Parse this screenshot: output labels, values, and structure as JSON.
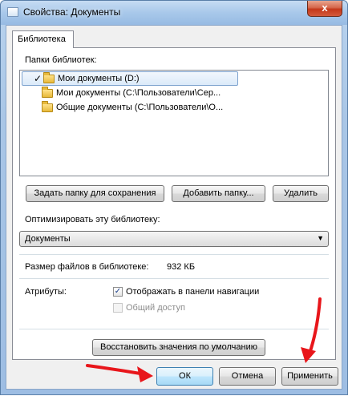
{
  "window": {
    "title": "Свойства: Документы",
    "close_glyph": "x"
  },
  "tabs": [
    {
      "label": "Библиотека"
    }
  ],
  "library": {
    "locations_label": "Папки библиотек:",
    "locations": [
      {
        "check": "✓",
        "text": "Мои документы (D:)"
      },
      {
        "check": "",
        "text": "Мои документы (C:\\Пользователи\\Сер..."
      },
      {
        "check": "",
        "text": "Общие документы (C:\\Пользователи\\О..."
      }
    ],
    "set_save_folder_button": "Задать папку для сохранения",
    "add_folder_button": "Добавить папку...",
    "remove_button": "Удалить",
    "optimize_label": "Оптимизировать эту библиотеку:",
    "optimize_value": "Документы",
    "size_label": "Размер файлов в библиотеке:",
    "size_value": "932 КБ",
    "attributes_label": "Атрибуты:",
    "show_in_nav_label": "Отображать в панели навигации",
    "show_in_nav_checked": "✓",
    "shared_label": "Общий доступ",
    "restore_defaults_button": "Восстановить значения по умолчанию"
  },
  "footer": {
    "ok_button": "ОК",
    "cancel_button": "Отмена",
    "apply_button": "Применить"
  },
  "annotations": {
    "arrow_color": "#e8161b"
  },
  "icons": {
    "check": "check-icon",
    "folder": "folder-icon",
    "dropdown": "chevron-down-icon"
  }
}
